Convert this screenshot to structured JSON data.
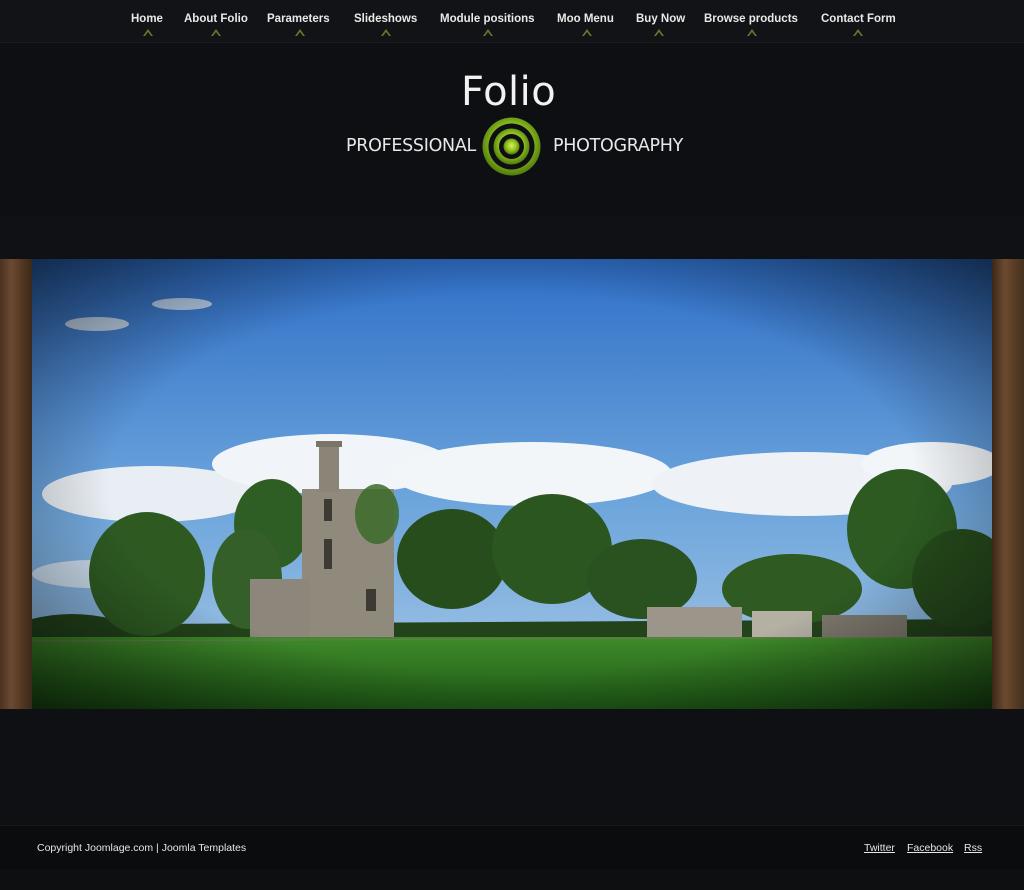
{
  "nav": {
    "items": [
      {
        "label": "Home"
      },
      {
        "label": "About Folio"
      },
      {
        "label": "Parameters"
      },
      {
        "label": "Slideshows"
      },
      {
        "label": "Module positions"
      },
      {
        "label": "Moo Menu"
      },
      {
        "label": "Buy Now"
      },
      {
        "label": "Browse products"
      },
      {
        "label": "Contact Form"
      }
    ]
  },
  "logo": {
    "title": "Folio",
    "left_text": "PROFESSIONAL",
    "right_text": "PHOTOGRAPHY",
    "accent_color": "#9ccc2e"
  },
  "slideshow": {
    "image": "castle-ruin-landscape"
  },
  "footer": {
    "copyright": "Copyright Joomlage.com | Joomla Templates",
    "links": [
      {
        "label": "Twitter"
      },
      {
        "label": "Facebook"
      },
      {
        "label": "Rss"
      }
    ]
  }
}
